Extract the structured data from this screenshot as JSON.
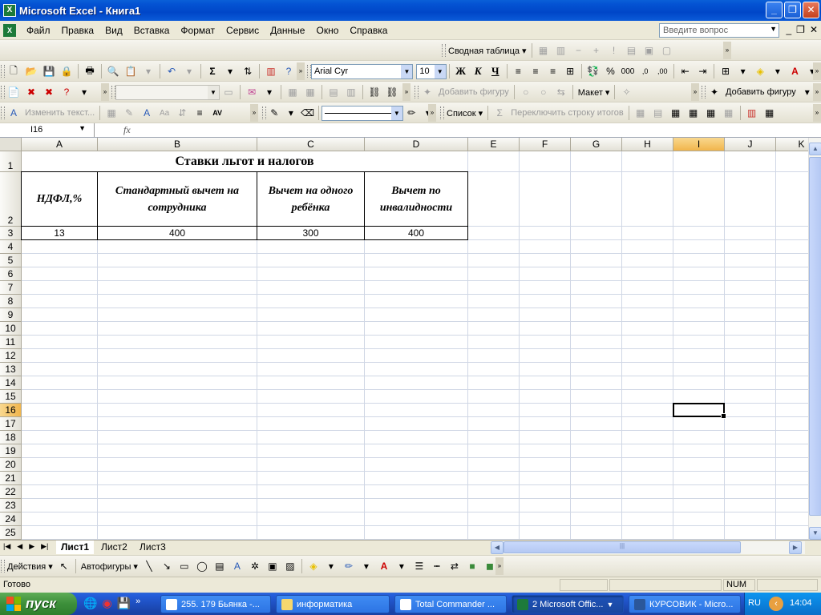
{
  "window": {
    "title": "Microsoft Excel - Книга1",
    "app_icon": "excel-icon"
  },
  "menu": {
    "items": [
      "Файл",
      "Правка",
      "Вид",
      "Вставка",
      "Формат",
      "Сервис",
      "Данные",
      "Окно",
      "Справка"
    ],
    "help_placeholder": "Введите вопрос"
  },
  "toolbars": {
    "pivot_label": "Сводная таблица ▾",
    "font_name": "Arial Cyr",
    "font_size": "10",
    "bold": "Ж",
    "italic": "К",
    "underline": "Ч",
    "percent": "%",
    "thousands": "000",
    "add_shape_disabled": "Добавить фигуру",
    "layout_label": "Макет ▾",
    "add_shape": "Добавить фигуру",
    "edit_text": "Изменить текст...",
    "list_label": "Список ▾",
    "toggle_totals": "Переключить строку итогов"
  },
  "formula_bar": {
    "name_box": "I16",
    "fx": "fx",
    "formula": ""
  },
  "sheet": {
    "columns": [
      "A",
      "B",
      "C",
      "D",
      "E",
      "F",
      "G",
      "H",
      "I",
      "J",
      "K"
    ],
    "selected_column": "I",
    "rows": [
      "1",
      "2",
      "3",
      "4",
      "5",
      "6",
      "7",
      "8",
      "9",
      "10",
      "11",
      "12",
      "13",
      "14",
      "15",
      "16",
      "17",
      "18",
      "19",
      "20",
      "21",
      "22",
      "23",
      "24",
      "25"
    ],
    "selected_row": "16",
    "title": "Ставки льгот и налогов",
    "headers": [
      "НДФЛ,%",
      "Стандартный вычет на сотрудника",
      "Вычет на одного ребёнка",
      "Вычет по инвалидности"
    ],
    "values": [
      "13",
      "400",
      "300",
      "400"
    ]
  },
  "sheet_tabs": {
    "tabs": [
      "Лист1",
      "Лист2",
      "Лист3"
    ],
    "active": "Лист1"
  },
  "drawing": {
    "actions": "Действия ▾",
    "autoshapes": "Автофигуры ▾"
  },
  "status": {
    "text": "Готово",
    "num": "NUM"
  },
  "taskbar": {
    "start": "пуск",
    "tasks": [
      {
        "label": "255. 179 Бьянка -...",
        "active": false
      },
      {
        "label": "информатика",
        "active": false
      },
      {
        "label": "Total Commander ...",
        "active": false
      },
      {
        "label": "2 Microsoft Offic...",
        "active": true
      },
      {
        "label": "КУРСОВИК - Micro...",
        "active": false
      }
    ],
    "lang": "RU",
    "clock": "14:04"
  },
  "colors": {
    "titlebar": "#0453d3",
    "start_green": "#3c8f3a",
    "selected_header": "#f1b54c",
    "gridline": "#d0d7e5"
  }
}
